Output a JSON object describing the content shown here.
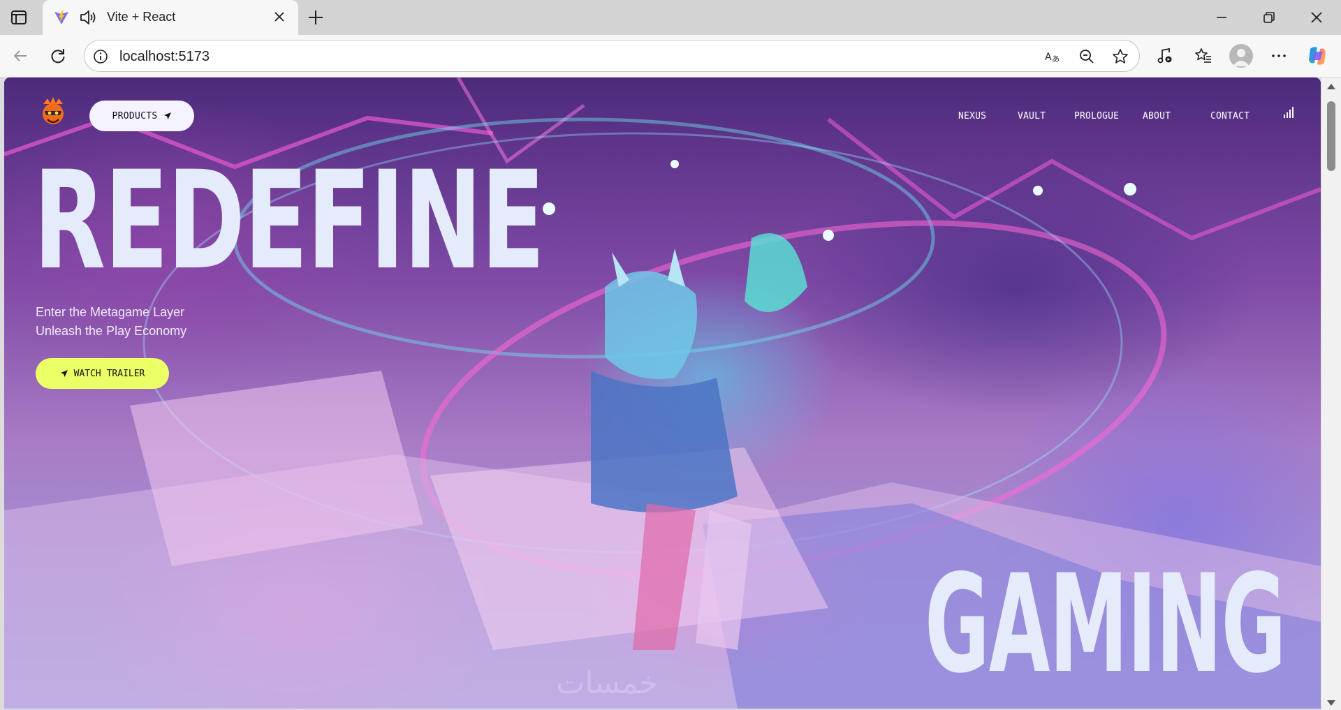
{
  "browser": {
    "tab": {
      "title": "Vite + React",
      "favicon": "vite-icon",
      "audio_icon": "speaker-icon",
      "close_icon": "close-icon"
    },
    "new_tab_icon": "plus-icon",
    "window_controls": [
      "minimize-icon",
      "restore-icon",
      "close-icon"
    ],
    "address": {
      "url": "localhost:5173",
      "info_icon": "info-icon"
    },
    "toolbar_icons": [
      "back-icon",
      "refresh-icon",
      "read-aloud-icon",
      "zoom-out-icon",
      "favorite-star-icon",
      "media-icon",
      "favorites-icon",
      "profile-avatar",
      "more-icon",
      "copilot-icon"
    ]
  },
  "site": {
    "nav": {
      "products_label": "PRODUCTS",
      "links": [
        "NEXUS",
        "VAULT",
        "PROLOGUE",
        "ABOUT",
        "CONTACT"
      ]
    },
    "hero": {
      "headline_top": "REDEFINE",
      "headline_bottom": "GAMING",
      "tagline_line1": "Enter the Metagame Layer",
      "tagline_line2": "Unleash the Play Economy",
      "cta_label": "WATCH TRAILER",
      "watermark": "خمسات"
    },
    "colors": {
      "headline": "#e4ecfc",
      "cta_background": "#edff66",
      "products_background": "#f5f3ff",
      "nav_text": "#ffffff"
    }
  }
}
